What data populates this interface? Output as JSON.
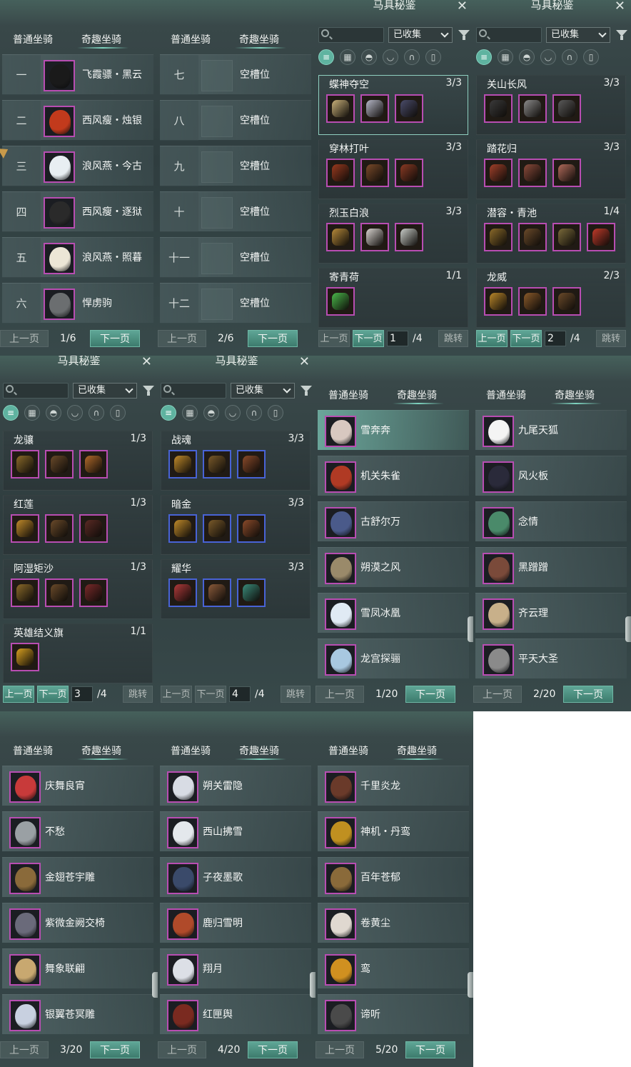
{
  "labels": {
    "tab_normal": "普通坐骑",
    "tab_fun": "奇趣坐骑",
    "prev": "上一页",
    "next": "下一页",
    "jump": "跳转",
    "codex_title": "马具秘鉴",
    "filter": "已收集",
    "empty_slot": "空槽位"
  },
  "colors": {
    "accent": "#5fa696",
    "rare_border": "#b84db2",
    "blue_border": "#4863d6"
  },
  "panel1": {
    "page": "1/6",
    "rows": [
      {
        "num": "一",
        "name": "飞霞骠・黑云",
        "art": "#1a1a1a"
      },
      {
        "num": "二",
        "name": "西风瘦・烛银",
        "art": "#c23a1c"
      },
      {
        "num": "三",
        "name": "浪风燕・今古",
        "art": "#e8eef2"
      },
      {
        "num": "四",
        "name": "西风瘦・逐狱",
        "art": "#2a2a2a"
      },
      {
        "num": "五",
        "name": "浪风燕・照暮",
        "art": "#ece6d6"
      },
      {
        "num": "六",
        "name": "悍虏驹",
        "art": "#6b6e70"
      }
    ]
  },
  "panel2": {
    "page": "2/6",
    "rows": [
      {
        "num": "七"
      },
      {
        "num": "八"
      },
      {
        "num": "九"
      },
      {
        "num": "十"
      },
      {
        "num": "十一"
      },
      {
        "num": "十二"
      }
    ]
  },
  "panel3": {
    "page_input": "1",
    "page_total": "/4",
    "cards": [
      {
        "title": "蝶神夺空",
        "count": "3/3",
        "slots": [
          "#c9b07a",
          "#b6b8c8",
          "#4a4c6a"
        ]
      },
      {
        "title": "穿林打叶",
        "count": "3/3",
        "slots": [
          "#9a3a1f",
          "#7a4a2a",
          "#8a3a24"
        ]
      },
      {
        "title": "烈玉白浪",
        "count": "3/3",
        "slots": [
          "#b68a3a",
          "#d8d4d0",
          "#c8ccc8"
        ]
      },
      {
        "title": "寄青荷",
        "count": "1/1",
        "slots": [
          "#4ab84a"
        ]
      }
    ]
  },
  "panel4": {
    "page_input": "2",
    "page_total": "/4",
    "cards": [
      {
        "title": "关山长风",
        "count": "3/3",
        "slots": [
          "#3a3a3a",
          "#8a8a8a",
          "#5a5a5a"
        ]
      },
      {
        "title": "踏花归",
        "count": "3/3",
        "slots": [
          "#a0402a",
          "#8a4a3a",
          "#b06a5a"
        ]
      },
      {
        "title": "潜容・青池",
        "count": "1/4",
        "slots": [
          "#8a6a2a",
          "#6a4a2a",
          "#7a6a3a",
          "#c03a2a"
        ]
      },
      {
        "title": "龙威",
        "count": "2/3",
        "slots": [
          "#b8862a",
          "#8a5a2a",
          "#6a4a2a"
        ]
      }
    ]
  },
  "panel5": {
    "page_input": "3",
    "page_total": "/4",
    "cards": [
      {
        "title": "龙骧",
        "count": "1/3",
        "slots": [
          "#8a6a2a",
          "#6a4a2a",
          "#b06a2a"
        ]
      },
      {
        "title": "红莲",
        "count": "1/3",
        "slots": [
          "#c08a2a",
          "#6a4a2a",
          "#5a2a24"
        ]
      },
      {
        "title": "阿湿矩沙",
        "count": "1/3",
        "slots": [
          "#8a6a2a",
          "#6a4a2a",
          "#7a2a2a"
        ]
      },
      {
        "title": "英雄结义旗",
        "count": "1/1",
        "slots": [
          "#d8a020"
        ]
      }
    ]
  },
  "panel6": {
    "page_input": "4",
    "page_total": "/4",
    "cards": [
      {
        "title": "战魂",
        "count": "3/3",
        "slots": [
          "#c08a2a",
          "#7a5a2a",
          "#8a4a2a"
        ]
      },
      {
        "title": "暗金",
        "count": "3/3",
        "slots": [
          "#c08a2a",
          "#7a5a2a",
          "#8a4a2a"
        ]
      },
      {
        "title": "耀华",
        "count": "3/3",
        "slots": [
          "#b03a3a",
          "#8a5a3a",
          "#3a8a7a"
        ]
      }
    ]
  },
  "panel7": {
    "page": "1/20",
    "rows": [
      {
        "name": "雪奔奔",
        "art": "#d8c8c0"
      },
      {
        "name": "机关朱雀",
        "art": "#b03a24"
      },
      {
        "name": "古舒尔万",
        "art": "#4a5a8a"
      },
      {
        "name": "朔漠之风",
        "art": "#9a8a6a"
      },
      {
        "name": "雪凤冰凰",
        "art": "#e0eaf4"
      },
      {
        "name": "龙宫探骊",
        "art": "#a8c8e0"
      }
    ]
  },
  "panel8": {
    "page": "2/20",
    "rows": [
      {
        "name": "九尾天狐",
        "art": "#f4f4f4"
      },
      {
        "name": "风火板",
        "art": "#2a2a3a"
      },
      {
        "name": "念情",
        "art": "#4a8a6a"
      },
      {
        "name": "黑蹭蹭",
        "art": "#7a4a3a"
      },
      {
        "name": "齐云理",
        "art": "#c8b08a"
      },
      {
        "name": "平天大圣",
        "art": "#8a8a8a"
      }
    ]
  },
  "panel9": {
    "page": "3/20",
    "rows": [
      {
        "name": "庆舞良宵",
        "art": "#c83a3a"
      },
      {
        "name": "不愁",
        "art": "#9aa0a4"
      },
      {
        "name": "金翅苍宇雕",
        "art": "#8a6a3a"
      },
      {
        "name": "紫微金阙交椅",
        "art": "#6a6a7a"
      },
      {
        "name": "舞象联翩",
        "art": "#c8a870"
      },
      {
        "name": "银翼苍冥雕",
        "art": "#c8d0e0"
      }
    ]
  },
  "panel10": {
    "page": "4/20",
    "rows": [
      {
        "name": "朔关雷隐",
        "art": "#d8dce4"
      },
      {
        "name": "西山拂雪",
        "art": "#e4e8ec"
      },
      {
        "name": "子夜墨歌",
        "art": "#3a4a6a"
      },
      {
        "name": "鹿归雪明",
        "art": "#b04a2a"
      },
      {
        "name": "翔月",
        "art": "#dcdfe6"
      },
      {
        "name": "红匣舆",
        "art": "#7a2a20"
      }
    ]
  },
  "panel11": {
    "page": "5/20",
    "rows": [
      {
        "name": "千里炎龙",
        "art": "#6a3a2a"
      },
      {
        "name": "神机・丹鸾",
        "art": "#c09020"
      },
      {
        "name": "百年苍郁",
        "art": "#8a6a3a"
      },
      {
        "name": "卷黄尘",
        "art": "#e0d8d0"
      },
      {
        "name": "鸾",
        "art": "#d09020"
      },
      {
        "name": "谛听",
        "art": "#4a4a4a"
      }
    ]
  }
}
